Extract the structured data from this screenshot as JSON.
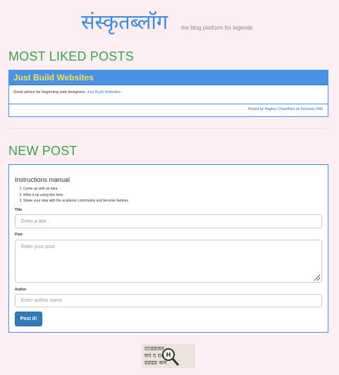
{
  "header": {
    "site_name": "संस्कृतब्लॉग",
    "tagline": "the blog platform for legends"
  },
  "liked": {
    "title": "MOST LIKED POSTS",
    "post": {
      "title": "Just Build Websites",
      "body_text": "Good advice for beginning web designers: ",
      "body_link": "Just Build Websites",
      "footer": "Posted by Raghav Chaudhary on February 24th"
    }
  },
  "new_post": {
    "title": "NEW POST",
    "instructions_title": "Instructions manual",
    "instructions": [
      "Come up with an idea",
      "Write it up using this form",
      "Share your idea with the academic community and become famous"
    ],
    "title_label": "Title",
    "title_placeholder": "Enter a title",
    "post_label": "Post",
    "post_placeholder": "Enter your post",
    "author_label": "Author",
    "author_placeholder": "Enter author name",
    "submit_label": "Post it!"
  },
  "footer": {
    "logo_rows": [
      "टटढढज़त",
      "घपं द ऱत",
      "ढढढढ कम"
    ],
    "logo_mark": "H"
  },
  "colors": {
    "background": "#fdeef3",
    "accent_green": "#3ea24a",
    "brand_blue": "#3d8be0",
    "panel_heading": "#4a93e4",
    "heading_text": "#f2e44f",
    "button": "#337ab7"
  }
}
